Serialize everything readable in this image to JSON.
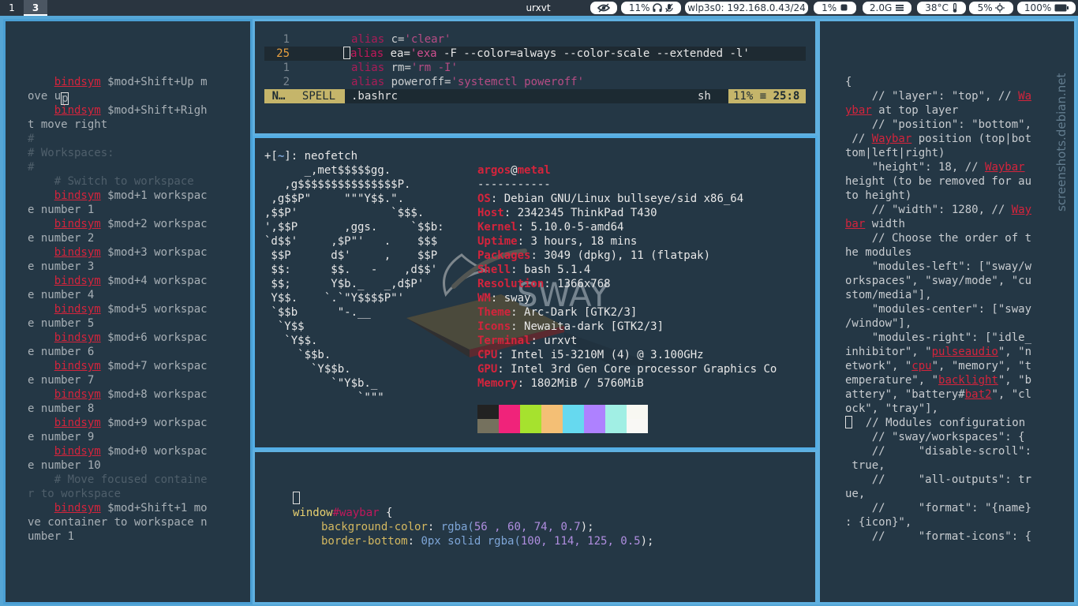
{
  "bar": {
    "workspaces": [
      "1",
      "3"
    ],
    "window_title": "urxvt",
    "modules": {
      "cpu": "11%",
      "network": "wlp3s0: 192.168.0.43/24",
      "cpu_load": "1%",
      "memory": "2.0G",
      "temperature": "38°C",
      "backlight": "5%",
      "battery": "100%"
    },
    "icons": {
      "idle": "eye-icon",
      "audio": "headphones-icon",
      "mic": "microphone-mute-icon",
      "cpu": "chip-icon",
      "memory": "memory-icon",
      "temp": "thermometer-icon",
      "backlight": "sun-icon",
      "battery": "battery-icon"
    }
  },
  "left_term": {
    "lines": [
      {
        "a": "    ",
        "r": "bindsym",
        "b": " $mod+Shift+Up m"
      },
      {
        "b": "ove up"
      },
      {
        "a": "    ",
        "r": "bindsym",
        "b": " $mod+Shift+Righ"
      },
      {
        "b": "t move right"
      },
      {
        "c": "#"
      },
      {
        "c": "# Workspaces:"
      },
      {
        "c": "#"
      },
      {
        "c": "    # Switch to workspace"
      },
      {
        "a": "    ",
        "r": "bindsym",
        "b": " $mod+1 workspac"
      },
      {
        "b": "e number 1"
      },
      {
        "a": "    ",
        "r": "bindsym",
        "b": " $mod+2 workspac"
      },
      {
        "b": "e number 2"
      },
      {
        "a": "    ",
        "r": "bindsym",
        "b": " $mod+3 workspac"
      },
      {
        "b": "e number 3"
      },
      {
        "a": "    ",
        "r": "bindsym",
        "b": " $mod+4 workspac"
      },
      {
        "b": "e number 4"
      },
      {
        "a": "    ",
        "r": "bindsym",
        "b": " $mod+5 workspac"
      },
      {
        "b": "e number 5"
      },
      {
        "a": "    ",
        "r": "bindsym",
        "b": " $mod+6 workspac"
      },
      {
        "b": "e number 6"
      },
      {
        "a": "    ",
        "r": "bindsym",
        "b": " $mod+7 workspac"
      },
      {
        "b": "e number 7"
      },
      {
        "a": "    ",
        "r": "bindsym",
        "b": " $mod+8 workspac"
      },
      {
        "b": "e number 8"
      },
      {
        "a": "    ",
        "r": "bindsym",
        "b": " $mod+9 workspac"
      },
      {
        "b": "e number 9"
      },
      {
        "a": "    ",
        "r": "bindsym",
        "b": " $mod+0 workspac"
      },
      {
        "b": "e number 10"
      },
      {
        "c": "    # Move focused containe"
      },
      {
        "c": "r to workspace"
      },
      {
        "a": "    ",
        "r": "bindsym",
        "b": " $mod+Shift+1 mo"
      },
      {
        "b": "ve container to workspace n"
      },
      {
        "b": "umber 1"
      }
    ]
  },
  "vim": {
    "lines": [
      {
        "num": "1",
        "kw": "alias",
        "rest": " c=",
        "str": "'clear'",
        "tail": ""
      },
      {
        "num": "25",
        "kw": "alias",
        "rest": " ea=",
        "str": "'exa",
        "tail": " -F --color=always --color-scale --extended -l'"
      },
      {
        "num": "1",
        "kw": "alias",
        "rest": " rm=",
        "str": "'rm -I'",
        "tail": ""
      },
      {
        "num": "2",
        "kw": "alias",
        "rest": " poweroff=",
        "str": "'systemctl poweroff'",
        "tail": ""
      }
    ],
    "status": {
      "mode": "N…",
      "spell": "SPELL",
      "file": ".bashrc",
      "filetype": "sh",
      "percent": "11%",
      "position": "25:8"
    }
  },
  "neofetch": {
    "prompt_user": "+[~]:",
    "prompt_cmd": " neofetch",
    "ascii": [
      "      _,met$$$$$gg.",
      "   ,g$$$$$$$$$$$$$$$P.",
      " ,g$$P\"     \"\"\"Y$$.\".",
      ",$$P'              `$$$.",
      "',$$P       ,ggs.     `$$b:",
      "`d$$'     ,$P\"'   .    $$$",
      " $$P      d$'     ,    $$P",
      " $$:      $$.   -    ,d$$'",
      " $$;      Y$b._   _,d$P'",
      " Y$$.    `.`\"Y$$$$P\"'",
      " `$$b      \"-.__",
      "  `Y$$",
      "   `Y$$.",
      "     `$$b.",
      "       `Y$$b.",
      "          `\"Y$b._",
      "              `\"\"\""
    ],
    "user": "argos",
    "host": "metal",
    "separator": "-----------",
    "info": [
      {
        "k": "OS",
        "v": "Debian GNU/Linux bullseye/sid x86_64"
      },
      {
        "k": "Host",
        "v": "2342345 ThinkPad T430"
      },
      {
        "k": "Kernel",
        "v": "5.10.0-5-amd64"
      },
      {
        "k": "Uptime",
        "v": "3 hours, 18 mins"
      },
      {
        "k": "Packages",
        "v": "3049 (dpkg), 11 (flatpak)"
      },
      {
        "k": "Shell",
        "v": "bash 5.1.4"
      },
      {
        "k": "Resolution",
        "v": "1366x768"
      },
      {
        "k": "WM",
        "v": "sway"
      },
      {
        "k": "Theme",
        "v": "Arc-Dark [GTK2/3]"
      },
      {
        "k": "Icons",
        "v": "Newaita-dark [GTK2/3]"
      },
      {
        "k": "Terminal",
        "v": "urxvt"
      },
      {
        "k": "CPU",
        "v": "Intel i5-3210M (4) @ 3.100GHz"
      },
      {
        "k": "GPU",
        "v": "Intel 3rd Gen Core processor Graphics Co"
      },
      {
        "k": "Memory",
        "v": "1802MiB / 5760MiB"
      }
    ],
    "palette_top": [
      "#222222",
      "#f0237a",
      "#a6e22e",
      "#f4bf75",
      "#66d9ef",
      "#ae81ff",
      "#a1efe4",
      "#f8f8f2"
    ],
    "palette_bottom": [
      "#75715e",
      "#f0237a",
      "#a6e22e",
      "#f4bf75",
      "#66d9ef",
      "#ae81ff",
      "#a1efe4",
      "#f9f8f5"
    ],
    "wallpaper_text": "SWAY"
  },
  "css_term": {
    "selector_a": "window",
    "selector_b": "#waybar",
    "brace": " {",
    "props": [
      {
        "k": "background-color",
        "v1": "rgba(",
        "v2": "56 , 60, 74, 0.7",
        "v3": ");"
      },
      {
        "k": "border-bottom",
        "v1": "0px solid rgba(",
        "v2": "100, 114, 125, 0.5",
        "v3": ");"
      }
    ]
  },
  "right_term": {
    "lines": [
      [
        {
          "t": "{"
        }
      ],
      [
        {
          "t": "    // \"layer\": \"top\", // "
        },
        {
          "r": "Wa"
        }
      ],
      [
        {
          "r": "ybar"
        },
        {
          "t": " at top layer"
        }
      ],
      [
        {
          "t": "    // \"position\": \"bottom\","
        }
      ],
      [
        {
          "t": " // "
        },
        {
          "r": "Waybar"
        },
        {
          "t": " position (top|bot"
        }
      ],
      [
        {
          "t": "tom|left|right)"
        }
      ],
      [
        {
          "t": "    \"height\": 18, // "
        },
        {
          "r": "Waybar"
        }
      ],
      [
        {
          "t": "height (to be removed for au"
        }
      ],
      [
        {
          "t": "to height)"
        }
      ],
      [
        {
          "t": "    // \"width\": 1280, // "
        },
        {
          "r": "Way"
        }
      ],
      [
        {
          "r": "bar"
        },
        {
          "t": " width"
        }
      ],
      [
        {
          "t": "    // Choose the order of t"
        }
      ],
      [
        {
          "t": "he modules"
        }
      ],
      [
        {
          "t": "    \"modules-left\": [\"sway/w"
        }
      ],
      [
        {
          "t": "orkspaces\", \"sway/mode\", \"cu"
        }
      ],
      [
        {
          "t": "stom/media\"],"
        }
      ],
      [
        {
          "t": "    \"modules-center\": [\"sway"
        }
      ],
      [
        {
          "t": "/window\"],"
        }
      ],
      [
        {
          "t": "    \"modules-right\": [\"idle_"
        }
      ],
      [
        {
          "t": "inhibitor\", \""
        },
        {
          "r": "pulseaudio"
        },
        {
          "t": "\", \"n"
        }
      ],
      [
        {
          "t": "etwork\", \""
        },
        {
          "r": "cpu"
        },
        {
          "t": "\", \"memory\", \"t"
        }
      ],
      [
        {
          "t": "emperature\", \""
        },
        {
          "r": "backlight"
        },
        {
          "t": "\", \"b"
        }
      ],
      [
        {
          "t": "attery\", \"battery#"
        },
        {
          "r": "bat2"
        },
        {
          "t": "\", \"cl"
        }
      ],
      [
        {
          "t": "ock\", \"tray\"],"
        }
      ],
      [
        {
          "cursor": true
        },
        {
          "t": "  // Modules configuration"
        }
      ],
      [
        {
          "t": "    // \"sway/workspaces\": {"
        }
      ],
      [
        {
          "t": "    //     \"disable-scroll\":"
        }
      ],
      [
        {
          "t": " true,"
        }
      ],
      [
        {
          "t": "    //     \"all-outputs\": tr"
        }
      ],
      [
        {
          "t": "ue,"
        }
      ],
      [
        {
          "t": "    //     \"format\": \"{name}"
        }
      ],
      [
        {
          "t": ": {icon}\","
        }
      ],
      [
        {
          "t": "    //     \"format-icons\": {"
        }
      ]
    ]
  },
  "watermark": "screenshots.debian.net"
}
